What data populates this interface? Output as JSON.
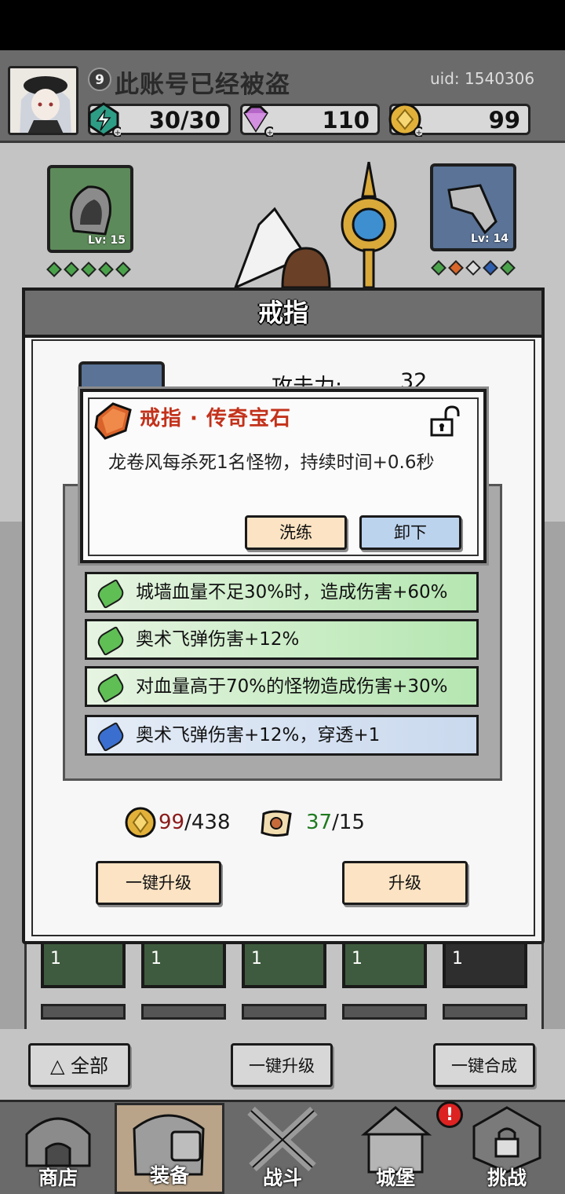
{
  "header": {
    "level": "9",
    "username": "此账号已经被盗",
    "uid": "uid: 1540306",
    "stamina": "30/30",
    "gems": "110",
    "gold": "99"
  },
  "equipment": {
    "left_slot_level": "Lv: 15",
    "right_slot_level": "Lv: 14"
  },
  "dialog": {
    "title": "戒指",
    "attack_label": "攻击力:",
    "attack_value": "32",
    "tooltip": {
      "title": "戒指 · 传奇宝石",
      "description": "龙卷风每杀死1名怪物，持续时间+0.6秒",
      "reforge_button": "洗练",
      "unequip_button": "卸下"
    },
    "affixes": [
      {
        "text": "城墙血量不足30%时，造成伤害+60%",
        "rarity": "green"
      },
      {
        "text": "奥术飞弹伤害+12%",
        "rarity": "green"
      },
      {
        "text": "对血量高于70%的怪物造成伤害+30%",
        "rarity": "green"
      },
      {
        "text": "奥术飞弹伤害+12%，穿透+1",
        "rarity": "blue"
      }
    ],
    "cost": {
      "gold_have": "99",
      "gold_need": "/438",
      "scroll_have": "37",
      "scroll_need": "/15"
    },
    "upgrade_all_button": "一键升级",
    "upgrade_button": "升级"
  },
  "inventory_cells": [
    {
      "count": "1"
    },
    {
      "count": "1"
    },
    {
      "count": "1"
    },
    {
      "count": "1"
    },
    {
      "count": "1"
    }
  ],
  "bottom_actions": {
    "filter_all": "全部",
    "upgrade_all": "一键升级",
    "merge_all": "一键合成"
  },
  "nav": {
    "shop": "商店",
    "equipment": "装备",
    "battle": "战斗",
    "castle": "城堡",
    "challenge": "挑战",
    "notification_badge": "!"
  },
  "colors": {
    "legend_title": "#c3321b",
    "gold_have": "#8b1a1a",
    "scroll_have": "#1f7a1f"
  }
}
